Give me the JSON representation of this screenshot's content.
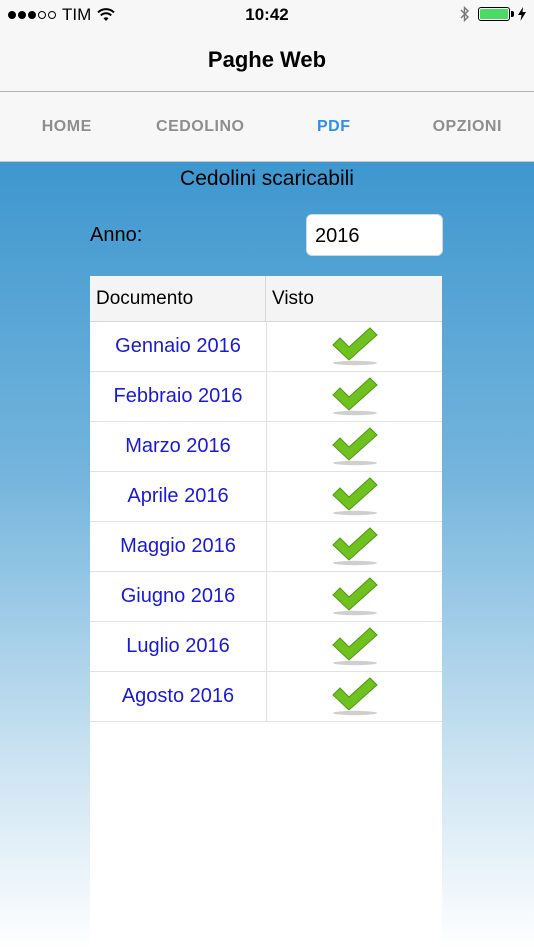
{
  "status_bar": {
    "carrier": "TIM",
    "time": "10:42",
    "signal_bars_filled": 3,
    "signal_bars_total": 5,
    "battery_level": 1.0,
    "battery_color": "#4cd964"
  },
  "nav": {
    "title": "Paghe Web"
  },
  "tabs": [
    {
      "label": "HOME",
      "active": false
    },
    {
      "label": "CEDOLINO",
      "active": false
    },
    {
      "label": "PDF",
      "active": true
    },
    {
      "label": "OPZIONI",
      "active": false
    }
  ],
  "colors": {
    "accent": "#2f8ff0",
    "link": "#1a1ad6",
    "check": "#6fc120"
  },
  "main": {
    "title": "Cedolini scaricabili",
    "anno_label": "Anno:",
    "anno_value": "2016"
  },
  "table": {
    "headers": {
      "documento": "Documento",
      "visto": "Visto"
    },
    "rows": [
      {
        "documento": "Gennaio 2016",
        "visto_icon": "checkmark-icon"
      },
      {
        "documento": "Febbraio 2016",
        "visto_icon": "checkmark-icon"
      },
      {
        "documento": "Marzo 2016",
        "visto_icon": "checkmark-icon"
      },
      {
        "documento": "Aprile 2016",
        "visto_icon": "checkmark-icon"
      },
      {
        "documento": "Maggio 2016",
        "visto_icon": "checkmark-icon"
      },
      {
        "documento": "Giugno 2016",
        "visto_icon": "checkmark-icon"
      },
      {
        "documento": "Luglio 2016",
        "visto_icon": "checkmark-icon"
      },
      {
        "documento": "Agosto 2016",
        "visto_icon": "checkmark-icon"
      }
    ]
  }
}
